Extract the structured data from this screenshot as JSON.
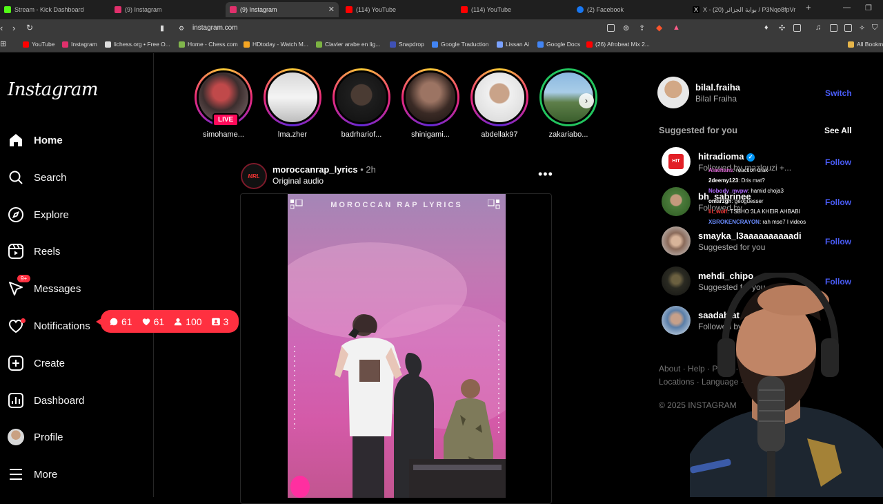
{
  "browser": {
    "tabs": [
      {
        "label": "Stream - Kick Dashboard",
        "color": "#53fc18"
      },
      {
        "label": "(9) Instagram",
        "color": "#e1306c"
      },
      {
        "label": "(9) Instagram",
        "color": "#e1306c",
        "active": true
      },
      {
        "label": "(114) YouTube",
        "color": "#ff0000"
      },
      {
        "label": "(114) YouTube",
        "color": "#ff0000"
      },
      {
        "label": "(2) Facebook",
        "color": "#1877f2"
      },
      {
        "label": "X - (20) بوابة الجزائر / P3Nqo8fpVr",
        "color": "#000000"
      }
    ],
    "new_tab": "+",
    "url": "instagram.com",
    "bookmarks": [
      {
        "label": "YouTube",
        "color": "#ff0000"
      },
      {
        "label": "Instagram",
        "color": "#e1306c"
      },
      {
        "label": "lichess.org • Free O...",
        "color": "#dddddd"
      },
      {
        "label": "Home - Chess.com",
        "color": "#81b64c"
      },
      {
        "label": "HDtoday - Watch M...",
        "color": "#f5a623"
      },
      {
        "label": "Clavier arabe en lig...",
        "color": "#7cb342"
      },
      {
        "label": "Snapdrop",
        "color": "#3f51b5"
      },
      {
        "label": "Google Traduction",
        "color": "#4285f4"
      },
      {
        "label": "Lissan Ai",
        "color": "#7aa2ff"
      },
      {
        "label": "Google Docs",
        "color": "#4285f4"
      },
      {
        "label": "(26) Afrobeat Mix 2...",
        "color": "#ff0000"
      }
    ],
    "all_bookmarks": "All Bookm"
  },
  "sidebar": {
    "logo": "Instagram",
    "items": [
      {
        "label": "Home",
        "icon": "home-icon"
      },
      {
        "label": "Search",
        "icon": "search-icon"
      },
      {
        "label": "Explore",
        "icon": "compass-icon"
      },
      {
        "label": "Reels",
        "icon": "reels-icon"
      },
      {
        "label": "Messages",
        "icon": "messenger-icon",
        "badge": "9+"
      },
      {
        "label": "Notifications",
        "icon": "heart-icon"
      },
      {
        "label": "Create",
        "icon": "plus-square-icon"
      },
      {
        "label": "Dashboard",
        "icon": "chart-icon"
      },
      {
        "label": "Profile",
        "icon": "avatar"
      },
      {
        "label": "More",
        "icon": "menu-icon"
      }
    ]
  },
  "notif_popup": {
    "comments": "61",
    "likes": "61",
    "follows": "100",
    "requests": "3"
  },
  "stories": [
    {
      "name": "simohame...",
      "live": "LIVE",
      "ring": "gradient"
    },
    {
      "name": "lma.zher",
      "ring": "gradient"
    },
    {
      "name": "badrhariof...",
      "ring": "gradient"
    },
    {
      "name": "shinigami...",
      "ring": "gradient"
    },
    {
      "name": "abdellak97",
      "ring": "gradient"
    },
    {
      "name": "zakariabo...",
      "ring": "green"
    }
  ],
  "post": {
    "username": "moroccanrap_lyrics",
    "time": "• 2h",
    "audio": "Original audio",
    "avatar_text": "MRL",
    "media_title": "MOROCCAN RAP LYRICS"
  },
  "account": {
    "username": "bilal.fraiha",
    "fullname": "Bilal Fraiha",
    "switch": "Switch"
  },
  "suggested": {
    "heading": "Suggested for you",
    "see_all": "See All",
    "items": [
      {
        "username": "hitradioma",
        "verified": true,
        "sub": "Followed by mazlouzi +...",
        "action": "Follow"
      },
      {
        "username": "bh_sabrinee",
        "sub": "Followed by ...",
        "action": "Follow"
      },
      {
        "username": "smayka_l3aaaaaaaaaadi",
        "sub": "Suggested for you",
        "action": "Follow"
      },
      {
        "username": "mehdi_chipo",
        "sub": "Suggested for you",
        "action": "Follow"
      },
      {
        "username": "saadablat",
        "sub": "Followed by m...",
        "action": "Follow"
      }
    ]
  },
  "footer": {
    "line1": "About · Help · Press · API · Jobs",
    "line2": "Locations · Language · Meta Ve",
    "copyright": "© 2025 INSTAGRAM"
  },
  "chat": [
    {
      "user": "Alaehans",
      "color": "#e06ad6",
      "msg": ": reaction drak"
    },
    {
      "user": "2deemy123",
      "color": "#ffffff",
      "msg": ": Dris mat?"
    },
    {
      "user": "Nobody_mvpw",
      "color": "#b06aff",
      "msg": ": hamid choja3"
    },
    {
      "user": "omarzgh",
      "color": "#ffffff",
      "msg": ": geoguesser"
    },
    {
      "user": "lil_wolf",
      "color": "#ff3b3b",
      "msg": ": TSBHO 3LA KHEIR AHBABI"
    },
    {
      "user": "XBROKENCRAYON",
      "color": "#6a8cff",
      "msg": ": rah mse7 l videos"
    }
  ]
}
